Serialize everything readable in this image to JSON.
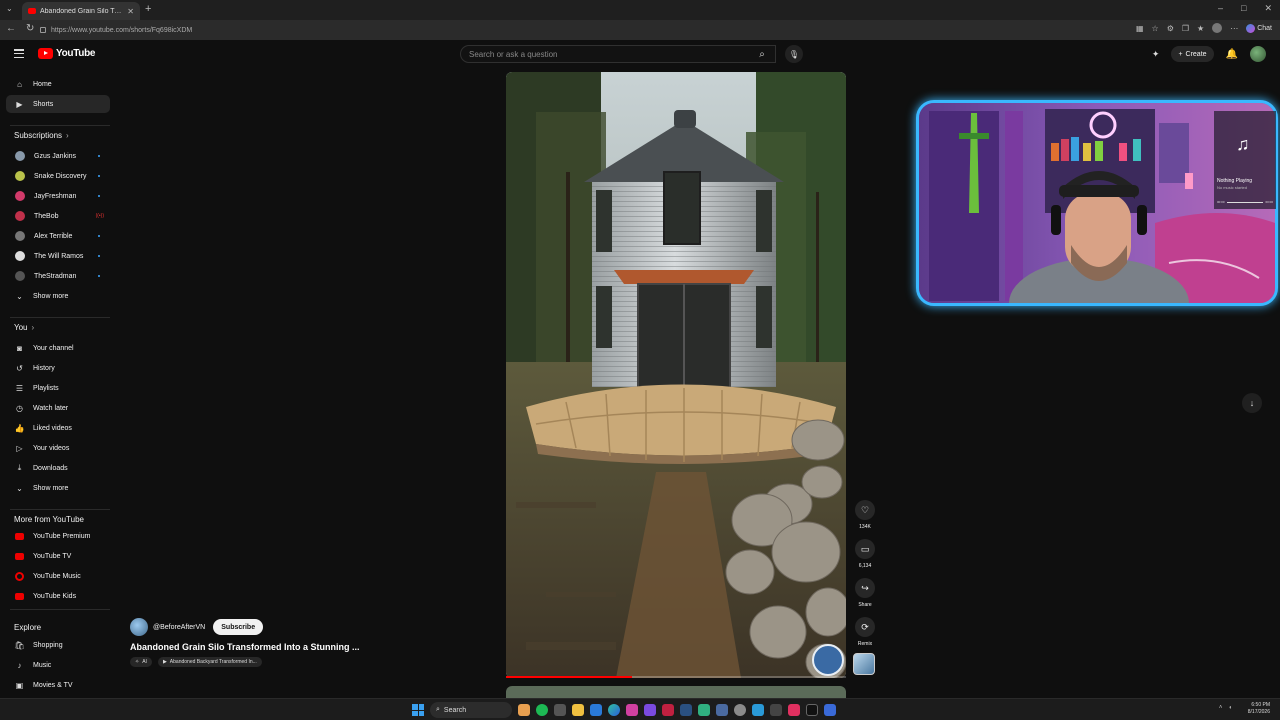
{
  "browser": {
    "tab_title": "Abandoned Grain Silo Transfo",
    "url": "https://www.youtube.com/shorts/Fq698icXDM",
    "chat_label": "Chat"
  },
  "header": {
    "logo_text": "YouTube",
    "search_placeholder": "Search or ask a question",
    "create_label": "Create"
  },
  "sidebar": {
    "main": [
      {
        "label": "Home",
        "icon": "home-icon"
      },
      {
        "label": "Shorts",
        "icon": "shorts-icon"
      }
    ],
    "subscriptions_heading": "Subscriptions",
    "subscriptions": [
      {
        "label": "Gzus Jankins",
        "color": "#8899aa",
        "live": false
      },
      {
        "label": "Snake Discovery",
        "color": "#b9c24a",
        "live": false
      },
      {
        "label": "JayFreshman",
        "color": "#d23a6a",
        "live": false
      },
      {
        "label": "TheBob",
        "color": "#c0304a",
        "live": true
      },
      {
        "label": "Alex Terrible",
        "color": "#777777",
        "live": false
      },
      {
        "label": "The Will Ramos",
        "color": "#dddddd",
        "live": false
      },
      {
        "label": "TheStradman",
        "color": "#555555",
        "live": false
      }
    ],
    "show_more_1": "Show more",
    "you_heading": "You",
    "you_items": [
      {
        "label": "Your channel",
        "icon": "channel-icon"
      },
      {
        "label": "History",
        "icon": "history-icon"
      },
      {
        "label": "Playlists",
        "icon": "playlists-icon"
      },
      {
        "label": "Watch later",
        "icon": "watch-later-icon"
      },
      {
        "label": "Liked videos",
        "icon": "like-icon"
      },
      {
        "label": "Your videos",
        "icon": "your-videos-icon"
      },
      {
        "label": "Downloads",
        "icon": "download-icon"
      }
    ],
    "show_more_2": "Show more",
    "more_heading": "More from YouTube",
    "more_items": [
      {
        "label": "YouTube Premium"
      },
      {
        "label": "YouTube TV"
      },
      {
        "label": "YouTube Music"
      },
      {
        "label": "YouTube Kids"
      }
    ],
    "explore_heading": "Explore",
    "explore_items": [
      {
        "label": "Shopping",
        "icon": "shopping-icon"
      },
      {
        "label": "Music",
        "icon": "music-icon"
      },
      {
        "label": "Movies & TV",
        "icon": "movies-icon"
      }
    ]
  },
  "short": {
    "channel": "@BeforeAfterVN",
    "subscribe_label": "Subscribe",
    "title": "Abandoned Grain Silo Transformed Into a Stunning ...",
    "tag_ai": "AI",
    "tag_sound": "Abandoned Backyard Transformed In...",
    "progress": 0.37,
    "likes": "134K",
    "comments": "6,134",
    "share_label": "Share",
    "remix_label": "Remix"
  },
  "overlay": {
    "now_playing_title": "Nothing Playing",
    "now_playing_sub": "No music started",
    "time_start": "00:00",
    "time_end": "00:00"
  },
  "taskbar": {
    "search_label": "Search",
    "time": "6:50 PM",
    "date": "8/17/2026"
  }
}
